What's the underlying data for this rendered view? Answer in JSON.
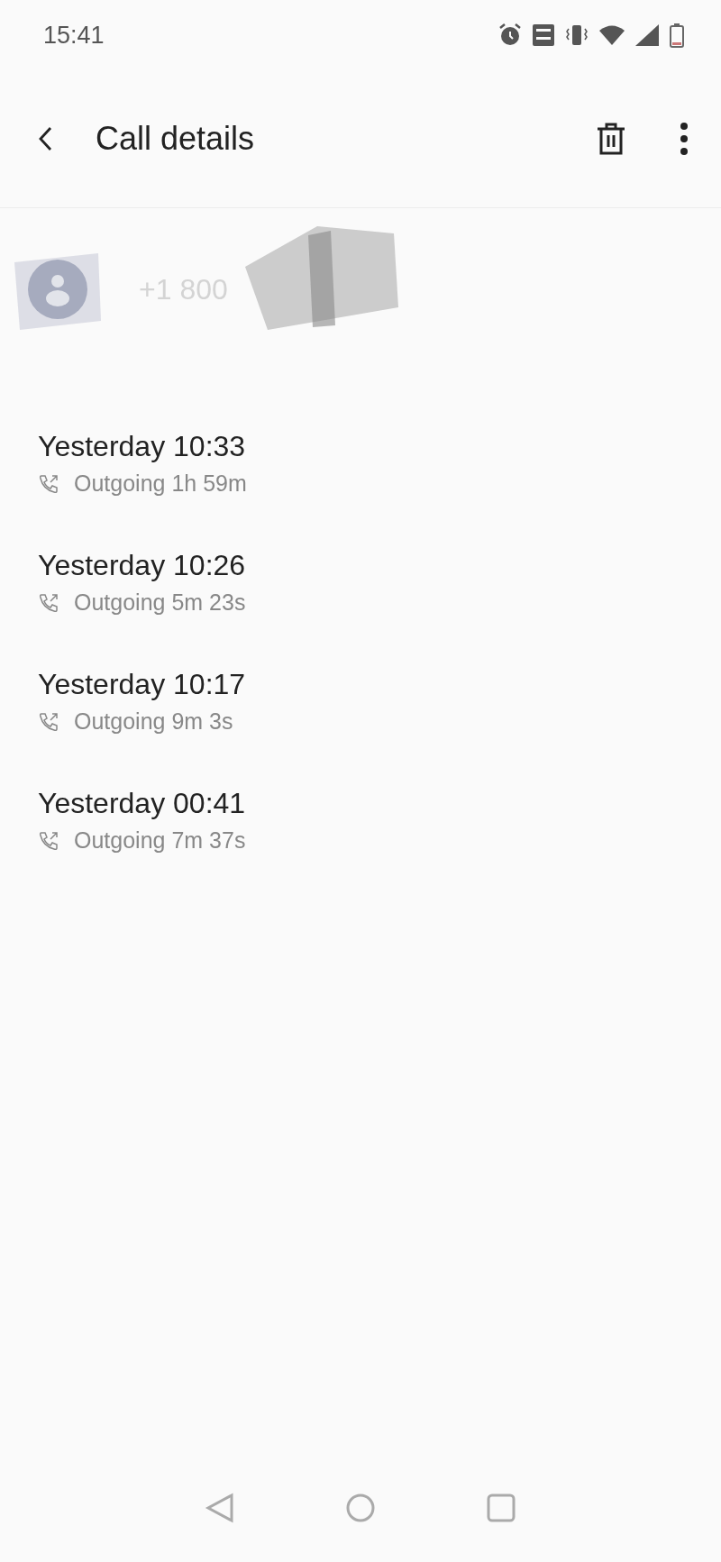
{
  "status_bar": {
    "time": "15:41"
  },
  "header": {
    "title": "Call details"
  },
  "contact": {
    "number": "+1 800"
  },
  "calls": [
    {
      "time": "Yesterday 10:33",
      "kind": "outgoing",
      "detail": "Outgoing 1h 59m"
    },
    {
      "time": "Yesterday 10:26",
      "kind": "outgoing",
      "detail": "Outgoing 5m 23s"
    },
    {
      "time": "Yesterday 10:17",
      "kind": "outgoing",
      "detail": "Outgoing 9m 3s"
    },
    {
      "time": "Yesterday 00:41",
      "kind": "outgoing",
      "detail": "Outgoing 7m 37s"
    }
  ]
}
